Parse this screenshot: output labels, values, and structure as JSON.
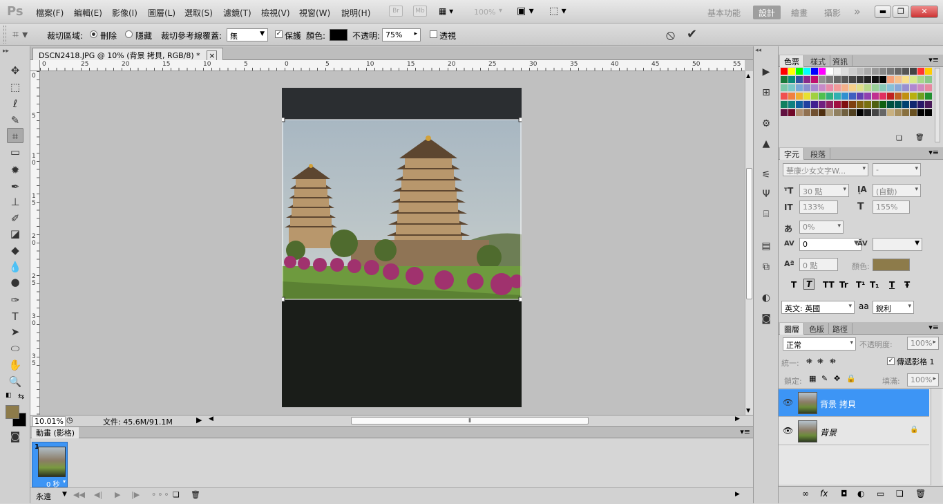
{
  "app": {
    "logo": "Ps"
  },
  "menu": [
    "檔案(F)",
    "編輯(E)",
    "影像(I)",
    "圖層(L)",
    "選取(S)",
    "濾鏡(T)",
    "檢視(V)",
    "視窗(W)",
    "說明(H)"
  ],
  "menubar_icons": {
    "bridge": "Br",
    "minibridge": "Mb",
    "zoom": "100%"
  },
  "workspaces": [
    "基本功能",
    "設計",
    "繪畫",
    "攝影"
  ],
  "workspace_active": "設計",
  "workspace_more": "»",
  "options": {
    "crop_area_label": "裁切區域:",
    "delete_label": "刪除",
    "hide_label": "隱藏",
    "overlay_label": "裁切參考線覆蓋:",
    "overlay_value": "無",
    "shield_label": "保護",
    "shield_checked": "✓",
    "color_label": "顏色:",
    "color_value": "#000000",
    "opacity_label": "不透明:",
    "opacity_value": "75%",
    "perspective_label": "透視",
    "cancel_icon": "⦸",
    "commit_icon": "✔"
  },
  "document": {
    "tab_title": "DSCN2418.JPG @ 10% (背景 拷貝, RGB/8) *",
    "tab_close": "×",
    "zoom": "10.01%",
    "file_info": "文件: 45.6M/91.1M",
    "ruler_h": [
      "0",
      "25",
      "20",
      "15",
      "10",
      "5",
      "0",
      "5",
      "10",
      "15",
      "20",
      "25",
      "30",
      "35",
      "40",
      "45",
      "50",
      "55"
    ],
    "ruler_v": [
      "0",
      "5",
      "1 0",
      "1 5",
      "2 0",
      "2 5",
      "3 0",
      "3 5"
    ]
  },
  "animation": {
    "panel_title": "動畫 (影格)",
    "frame_number": "1",
    "frame_delay": "0 秒",
    "loop": "永遠"
  },
  "swatches_panel": {
    "tabs": [
      "色票",
      "樣式",
      "資訊"
    ]
  },
  "character_panel": {
    "tabs": [
      "字元",
      "段落"
    ],
    "font_family": "華康少女文字W...",
    "font_style": "-",
    "font_size": "30 點",
    "leading": "(自動)",
    "vscale": "133%",
    "hscale": "155%",
    "tsume": "0%",
    "kerning": "0",
    "tracking": "",
    "baseline": "0 點",
    "color_label": "顏色:",
    "text_color": "#8d7b4a",
    "language": "英文: 英國",
    "antialias_icon": "aa",
    "antialias": "銳利",
    "style_buttons": [
      "T",
      "T",
      "TT",
      "Tr",
      "T¹",
      "T₁",
      "T",
      "Ŧ"
    ]
  },
  "layers_panel": {
    "tabs": [
      "圖層",
      "色版",
      "路徑"
    ],
    "blend_mode": "正常",
    "opacity_label": "不透明度:",
    "opacity": "100%",
    "unify_label": "統一:",
    "propagate_label": "傳遞影格 1",
    "lock_label": "鎖定:",
    "fill_label": "填滿:",
    "fill": "100%",
    "layers": [
      {
        "name": "背景 拷貝"
      },
      {
        "name": "背景"
      }
    ],
    "footer_icons": [
      "∞",
      "fx",
      "◘",
      "◐",
      "▭",
      "❏",
      "🗑"
    ]
  },
  "colors": {
    "foreground": "#8d7b4a",
    "background": "#000000",
    "selection": "#3d95f5"
  }
}
